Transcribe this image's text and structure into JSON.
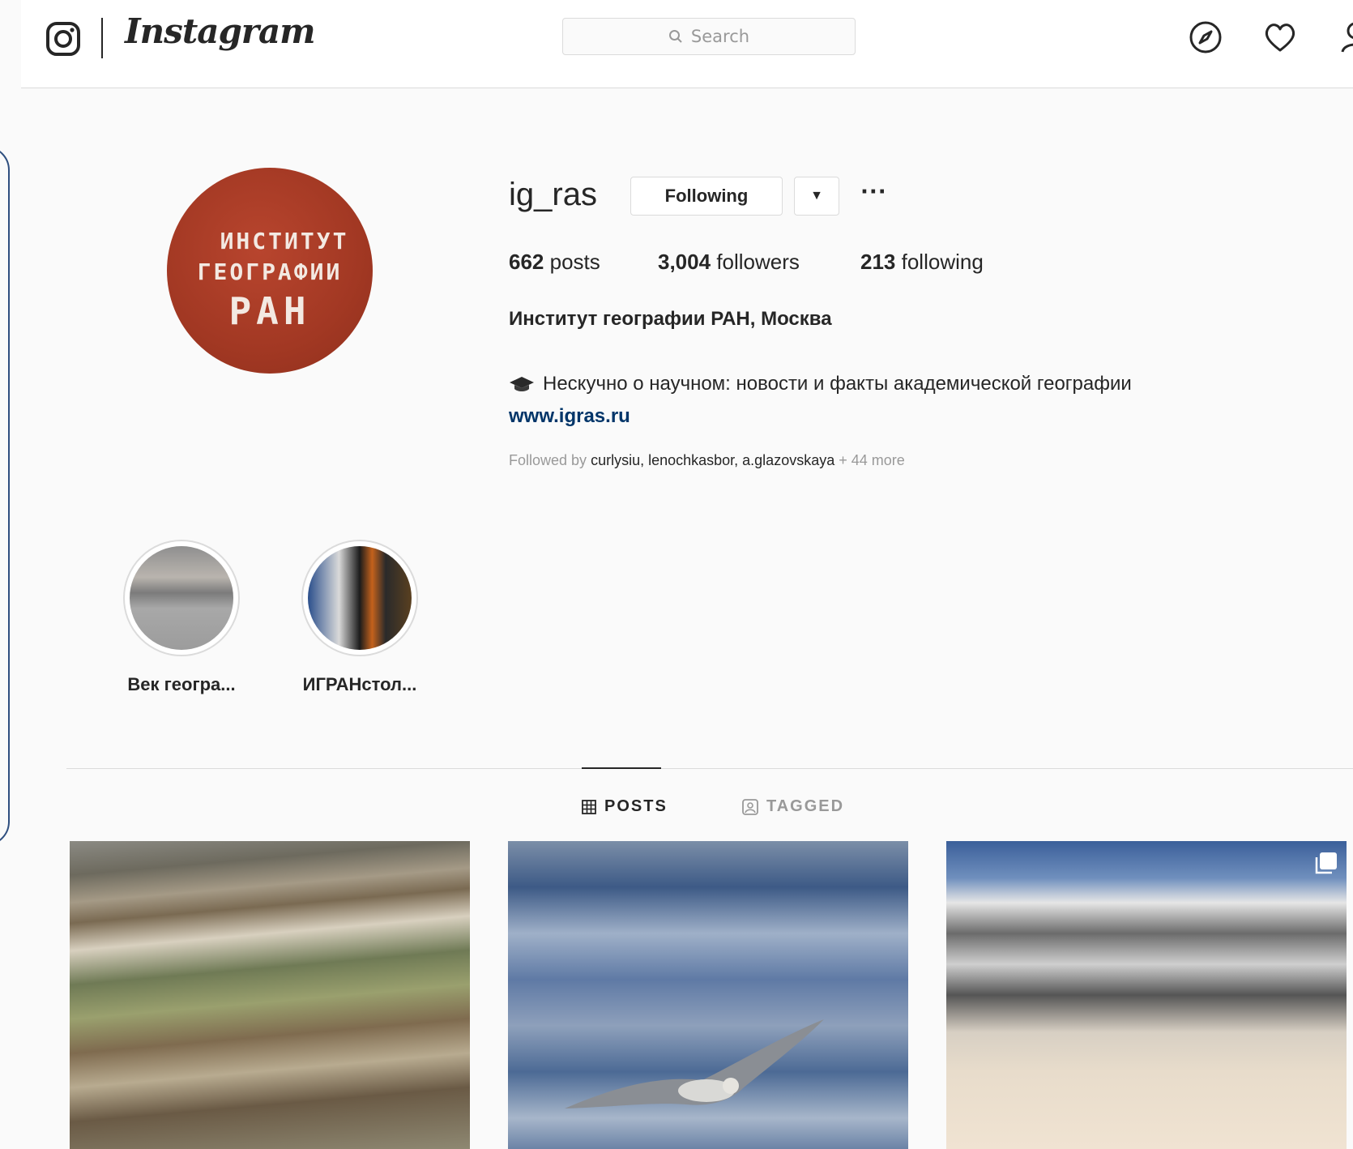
{
  "nav": {
    "wordmark": "Instagram",
    "search_placeholder": "Search",
    "icons": [
      "instagram-glyph-icon",
      "explore-compass-icon",
      "heart-icon",
      "profile-icon"
    ]
  },
  "profile": {
    "username": "ig_ras",
    "following_button": "Following",
    "caret": "▼",
    "more": "···",
    "avatar_lines": [
      "ИНСТИТУТ",
      "ГЕОГРАФИИ",
      "РАН"
    ],
    "stats": {
      "posts_count": "662",
      "posts_label": "posts",
      "followers_count": "3,004",
      "followers_label": "followers",
      "following_count": "213",
      "following_label": "following"
    },
    "full_name": "Институт географии РАН, Москва",
    "bio": "Нескучно о научном: новости и факты академической географии",
    "website": "www.igras.ru",
    "followed_by_prefix": "Followed by",
    "followed_by_names": "curlysiu, lenochkasbor, a.glazovskaya",
    "followed_by_more": "+ 44 more"
  },
  "highlights": [
    {
      "label": "Век геогра..."
    },
    {
      "label": "ИГРАНстол..."
    }
  ],
  "tabs": {
    "posts": "POSTS",
    "tagged": "TAGGED"
  },
  "colors": {
    "background": "#fafafa",
    "border": "#dbdbdb",
    "link": "#003569",
    "muted": "#999999",
    "avatar_red": "#a23823"
  }
}
